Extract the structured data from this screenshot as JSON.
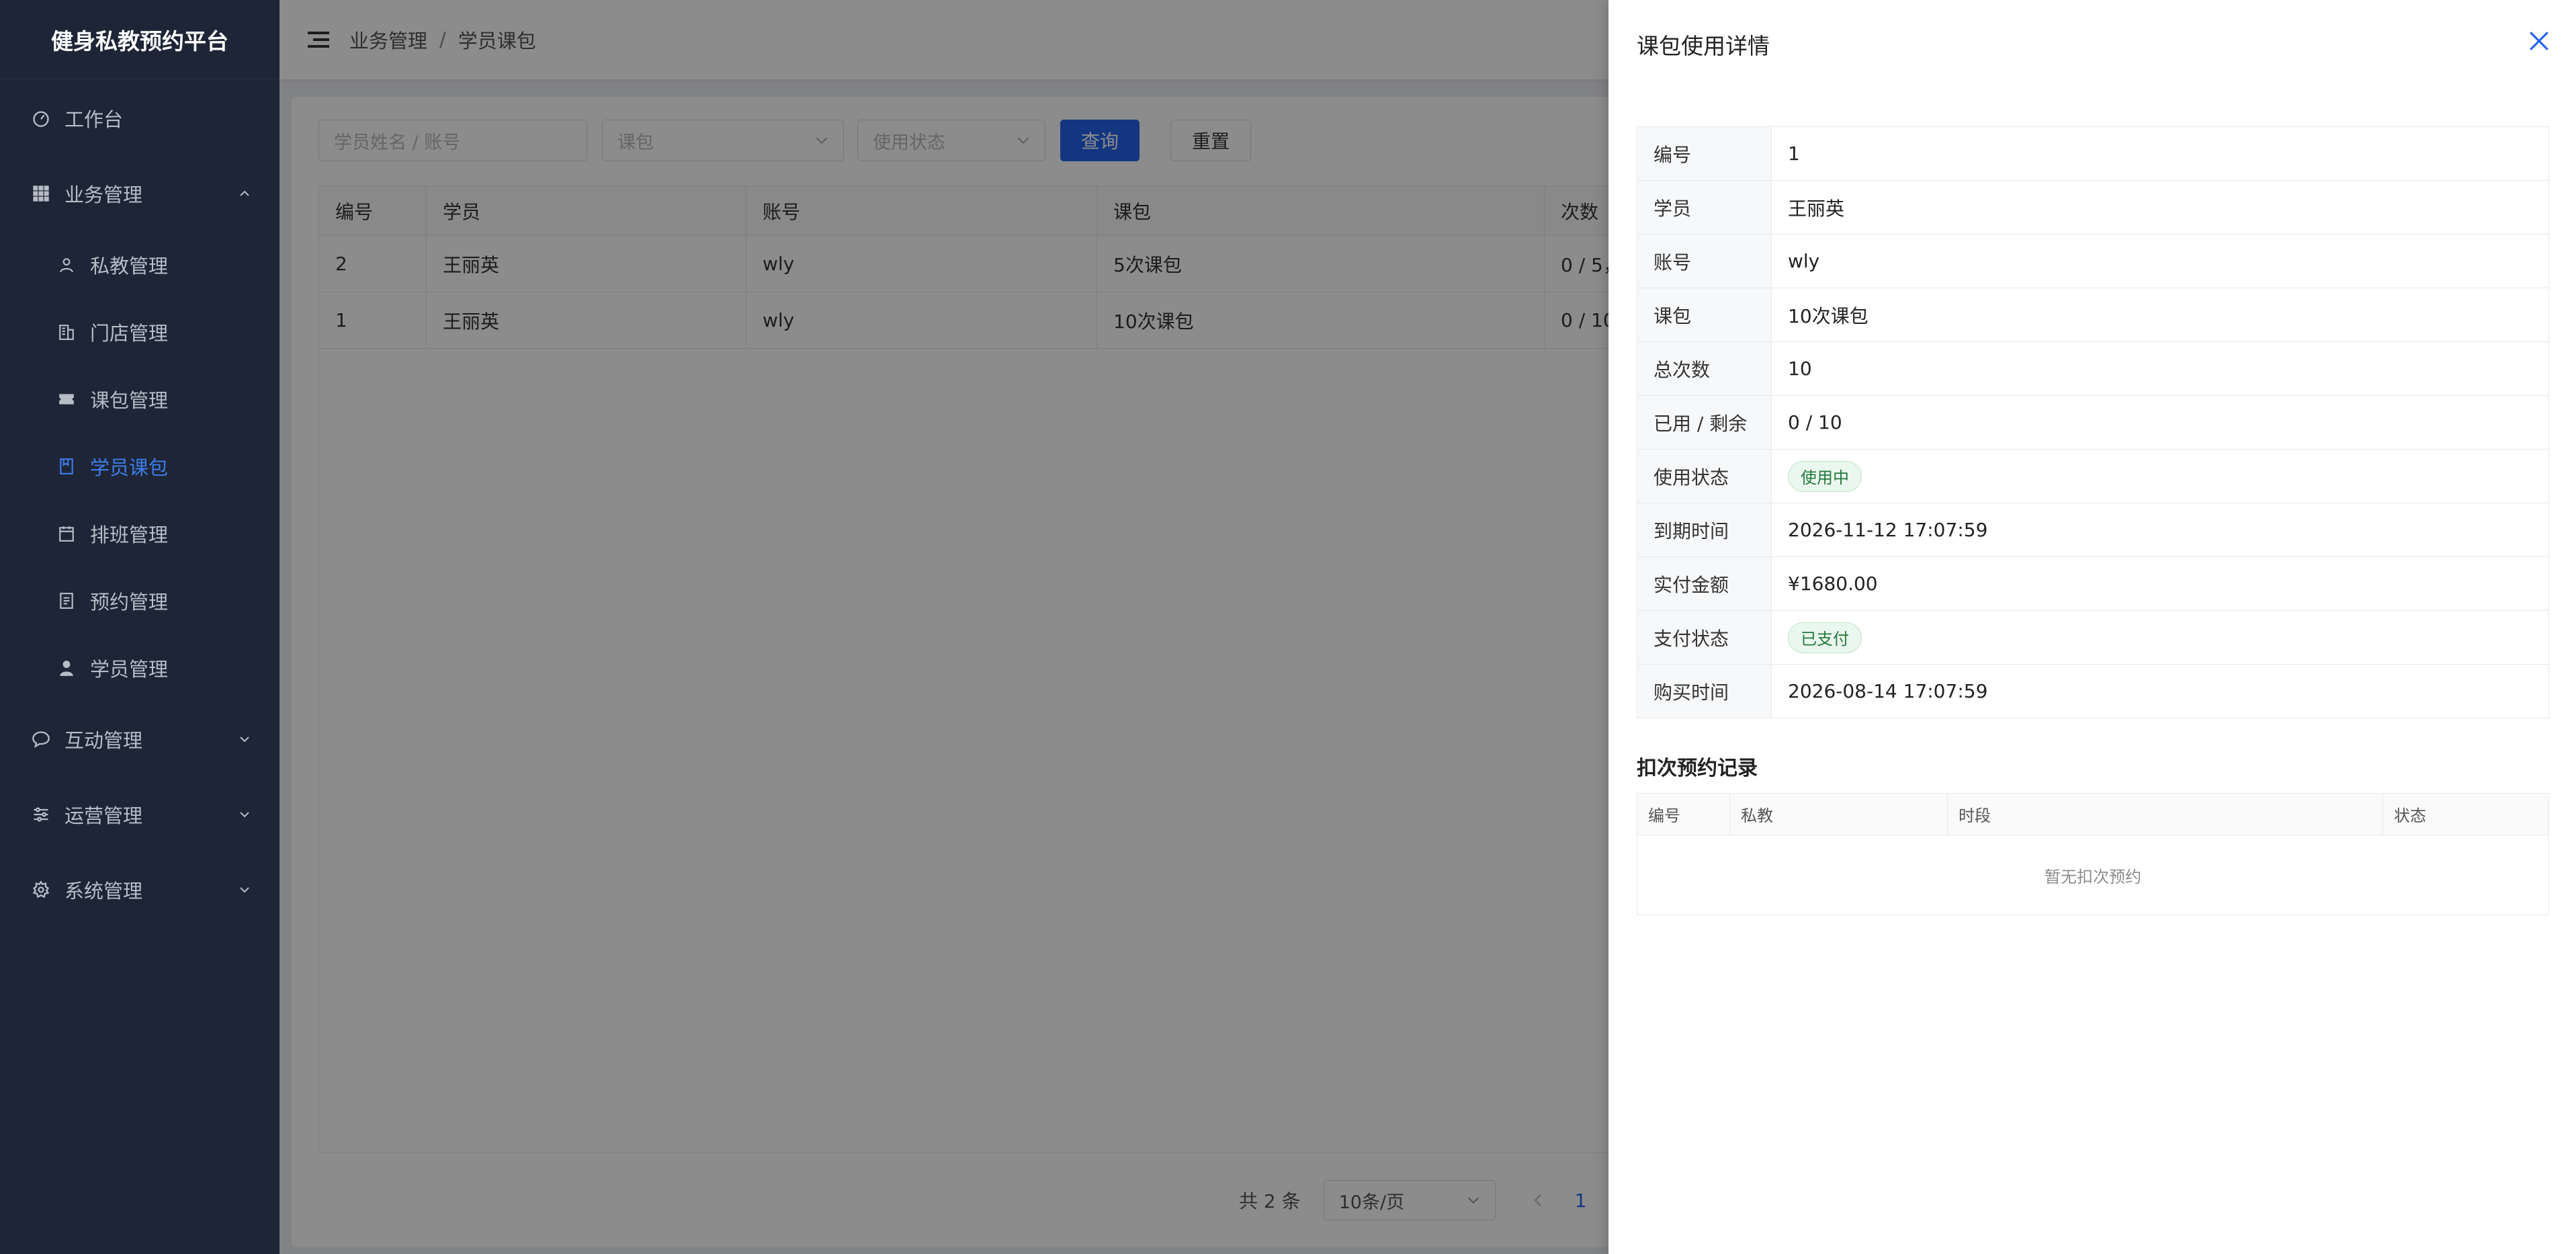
{
  "app": {
    "title": "健身私教预约平台"
  },
  "sidebar": {
    "items": [
      {
        "label": "工作台"
      },
      {
        "label": "业务管理"
      },
      {
        "label": "互动管理"
      },
      {
        "label": "运营管理"
      },
      {
        "label": "系统管理"
      }
    ],
    "business_sub": [
      {
        "label": "私教管理"
      },
      {
        "label": "门店管理"
      },
      {
        "label": "课包管理"
      },
      {
        "label": "学员课包"
      },
      {
        "label": "排班管理"
      },
      {
        "label": "预约管理"
      },
      {
        "label": "学员管理"
      }
    ],
    "active": "学员课包"
  },
  "breadcrumb": {
    "level1": "业务管理",
    "sep": "/",
    "level2": "学员课包"
  },
  "filters": {
    "search_placeholder": "学员姓名 / 账号",
    "package_placeholder": "课包",
    "status_placeholder": "使用状态",
    "query_label": "查询",
    "reset_label": "重置"
  },
  "list_table": {
    "columns": [
      "编号",
      "学员",
      "账号",
      "课包",
      "次数"
    ],
    "rows": [
      [
        "2",
        "王丽英",
        "wly",
        "5次课包",
        "0 / 5，"
      ],
      [
        "1",
        "王丽英",
        "wly",
        "10次课包",
        "0 / 10"
      ]
    ]
  },
  "pager": {
    "total": "共 2 条",
    "page_size": "10条/页",
    "current": "1"
  },
  "drawer": {
    "title": "课包使用详情",
    "fields": [
      {
        "label": "编号",
        "value": "1"
      },
      {
        "label": "学员",
        "value": "王丽英"
      },
      {
        "label": "账号",
        "value": "wly"
      },
      {
        "label": "课包",
        "value": "10次课包"
      },
      {
        "label": "总次数",
        "value": "10"
      },
      {
        "label": "已用 / 剩余",
        "value": "0 / 10"
      },
      {
        "label": "使用状态",
        "value": "使用中",
        "tag": true
      },
      {
        "label": "到期时间",
        "value": "2026-11-12 17:07:59"
      },
      {
        "label": "实付金额",
        "value": "¥1680.00"
      },
      {
        "label": "支付状态",
        "value": "已支付",
        "tag": true
      },
      {
        "label": "购买时间",
        "value": "2026-08-14 17:07:59"
      }
    ],
    "records_title": "扣次预约记录",
    "records_columns": [
      "编号",
      "私教",
      "时段",
      "状态"
    ],
    "records_empty": "暂无扣次预约"
  },
  "colors": {
    "sidebar_bg": "#1d2536",
    "accent": "#2563eb",
    "active_menu": "#3f7de8",
    "tag_green": "#257a3e"
  }
}
